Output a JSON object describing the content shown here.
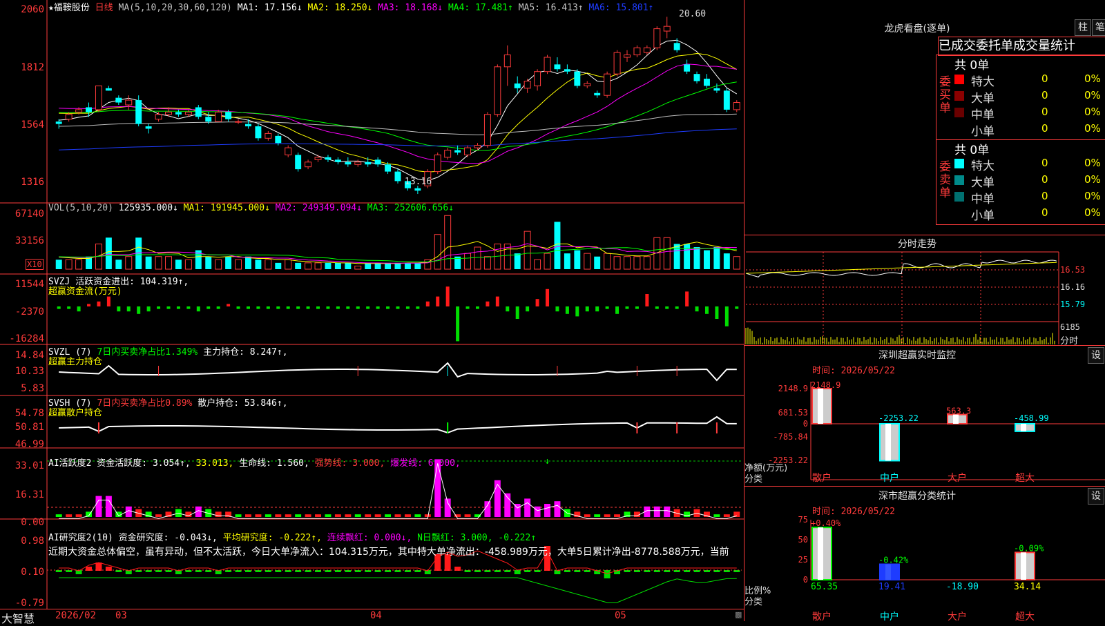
{
  "stock": {
    "name": "★福鞍股份",
    "period": "日线",
    "date_axis": [
      "2026/02",
      "03",
      "04",
      "05"
    ],
    "logo": "大智慧"
  },
  "main_panel": {
    "ma_params": "MA(5,10,20,30,60,120)",
    "ma": [
      {
        "label": "MA1: 17.156↓",
        "color": "#ffffff"
      },
      {
        "label": "MA2: 18.250↓",
        "color": "#ffff00"
      },
      {
        "label": "MA3: 18.168↓",
        "color": "#ff00ff"
      },
      {
        "label": "MA4: 17.481↑",
        "color": "#00ff00"
      },
      {
        "label": "MA5: 16.413↑",
        "color": "#c0c0c0"
      },
      {
        "label": "MA6: 15.801↑",
        "color": "#1e3cff"
      }
    ],
    "y_ticks": [
      "2060",
      "1812",
      "1564",
      "1316"
    ],
    "high_label": "20.60",
    "low_label": "13.16"
  },
  "vol_panel": {
    "legend_name": "VOL(5,10,20)",
    "value": "125935.000↓",
    "ma": [
      {
        "label": "MA1: 191945.000↓",
        "color": "#ffffff"
      },
      {
        "label": "MA2: 249349.094↓",
        "color": "#ff00ff"
      },
      {
        "label": "MA3: 252606.656↓",
        "color": "#00ff00"
      }
    ],
    "y_ticks": [
      "67140",
      "33156"
    ],
    "multiplier": "X10"
  },
  "svzj_panel": {
    "legend": "SVZJ  活跃资金进出: 104.319↑,",
    "title": "超赢资金流(万元)",
    "y_ticks": [
      "11544",
      "-2370",
      "-16284"
    ]
  },
  "svzl_panel": {
    "legend_a": "SVZL (7)",
    "legend_b": "7日内买卖净占比1.349%",
    "legend_c": "主力持仓: 8.247↑,",
    "title": "超赢主力持仓",
    "y_ticks": [
      "14.84",
      "10.33",
      "5.83"
    ]
  },
  "svsh_panel": {
    "legend_a": "SVSH (7)",
    "legend_b": "7日内买卖净占比0.89%",
    "legend_c": "散户持仓: 53.846↑,",
    "title": "超赢散户持仓",
    "y_ticks": [
      "54.78",
      "50.81",
      "46.99"
    ]
  },
  "ai_active_panel": {
    "legend_a": "AI活跃度2 资金活跃度: 3.054↑,",
    "legend_b": "33.013,",
    "legend_c": "生命线: 1.560,",
    "legend_d": "强势线: 3.000,",
    "legend_e": "爆发线: 6.000,",
    "y_ticks": [
      "33.01",
      "16.31",
      "0.00"
    ]
  },
  "ai_research_panel": {
    "legend_a": "AI研究度2(10) 资金研究度: -0.043↓,",
    "legend_b": "平均研究度: -0.222↑,",
    "legend_c": "连续飘红: 0.000↓,",
    "legend_d": "N日飘红: 3.000, -0.222↑",
    "commentary": "近期大资金总体偏空，虽有异动，但不太活跃，今日大单净流入：104.315万元，其中特大单净流出：-458.989万元，大单5日累计净出-8778.588万元，当前",
    "y_ticks": [
      "0.98",
      "0.10",
      "-0.79"
    ]
  },
  "longhu": {
    "title": "龙虎看盘(逐单)",
    "btn_a": "柱",
    "btn_b": "笔",
    "header": "已成交委托单成交量统计",
    "buy_label": "委买单",
    "sell_label": "委卖单",
    "buy_total": "共 0单",
    "sell_total": "共 0单",
    "buy_rows": [
      {
        "name": "特大",
        "count": "0",
        "pct": "0%",
        "color": "#ff0000"
      },
      {
        "name": "大单",
        "count": "0",
        "pct": "0%",
        "color": "#8b0000"
      },
      {
        "name": "中单",
        "count": "0",
        "pct": "0%",
        "color": "#6a0000"
      },
      {
        "name": "小单",
        "count": "0",
        "pct": "0%",
        "color": ""
      }
    ],
    "sell_rows": [
      {
        "name": "特大",
        "count": "0",
        "pct": "0%",
        "color": "#00ffff"
      },
      {
        "name": "大单",
        "count": "0",
        "pct": "0%",
        "color": "#008b8b"
      },
      {
        "name": "中单",
        "count": "0",
        "pct": "0%",
        "color": "#007070"
      },
      {
        "name": "小单",
        "count": "0",
        "pct": "0%",
        "color": ""
      }
    ]
  },
  "intraday": {
    "title": "分时走势",
    "price_ticks": [
      "16.53",
      "16.16",
      "15.79"
    ],
    "vol_tick": "6185",
    "vol_unit": "分时"
  },
  "sz_monitor": {
    "title": "深圳超赢实时监控",
    "btn": "设",
    "time": "时间: 2026/05/22",
    "y_ticks": [
      "2148.9",
      "681.53",
      "0",
      "-785.84",
      "-2253.22"
    ],
    "unit_a": "净额(万元)",
    "unit_b": "分类",
    "bars": [
      {
        "cat": "散户",
        "label": "2148.9"
      },
      {
        "cat": "中户",
        "label": "-2253.22"
      },
      {
        "cat": "大户",
        "label": "563.3"
      },
      {
        "cat": "超大",
        "label": "-458.99"
      }
    ]
  },
  "sz_classify": {
    "title": "深市超赢分类统计",
    "btn": "设",
    "time": "时间: 2026/05/22",
    "y_ticks": [
      "75",
      "50",
      "25",
      "0"
    ],
    "unit_a": "比例%",
    "unit_b": "分类",
    "bars": [
      {
        "cat": "散户",
        "top": "+0.40%",
        "bottom": "65.35"
      },
      {
        "cat": "中户",
        "top": "-0.42%",
        "bottom": "19.41"
      },
      {
        "cat": "大户",
        "top": "",
        "bottom": "-18.90"
      },
      {
        "cat": "超大",
        "top": "-0.09%",
        "bottom": "34.14"
      }
    ]
  },
  "chart_data": {
    "type": "candlestick",
    "ohlc": [
      [
        16.2,
        16.3,
        15.9,
        16.1
      ],
      [
        16.3,
        16.6,
        16.2,
        16.5
      ],
      [
        16.6,
        16.8,
        16.5,
        16.7
      ],
      [
        16.8,
        17.0,
        16.4,
        16.6
      ],
      [
        16.7,
        17.7,
        16.6,
        17.7
      ],
      [
        17.6,
        17.7,
        17.5,
        17.5
      ],
      [
        17.2,
        17.3,
        16.9,
        17.0
      ],
      [
        16.9,
        17.3,
        16.7,
        17.1
      ],
      [
        17.1,
        17.3,
        16.0,
        16.1
      ],
      [
        16.0,
        16.1,
        15.7,
        15.9
      ],
      [
        16.3,
        16.6,
        16.2,
        16.5
      ],
      [
        16.5,
        16.8,
        16.4,
        16.6
      ],
      [
        16.6,
        16.7,
        16.4,
        16.5
      ],
      [
        16.5,
        16.7,
        16.4,
        16.6
      ],
      [
        16.8,
        16.9,
        16.3,
        16.4
      ],
      [
        16.4,
        16.6,
        16.1,
        16.2
      ],
      [
        16.2,
        16.7,
        16.2,
        16.6
      ],
      [
        16.6,
        16.7,
        16.2,
        16.3
      ],
      [
        16.2,
        16.3,
        16.1,
        16.2
      ],
      [
        16.1,
        16.3,
        15.9,
        16.0
      ],
      [
        16.0,
        16.1,
        15.4,
        15.5
      ],
      [
        15.5,
        15.8,
        15.4,
        15.7
      ],
      [
        15.6,
        15.7,
        15.2,
        15.3
      ],
      [
        14.8,
        15.2,
        14.7,
        15.1
      ],
      [
        14.8,
        14.9,
        14.1,
        14.2
      ],
      [
        14.3,
        14.6,
        14.2,
        14.5
      ],
      [
        14.6,
        14.8,
        14.5,
        14.7
      ],
      [
        14.7,
        14.8,
        14.5,
        14.6
      ],
      [
        14.6,
        14.7,
        14.4,
        14.5
      ],
      [
        14.5,
        14.7,
        14.3,
        14.4
      ],
      [
        14.4,
        14.6,
        14.3,
        14.5
      ],
      [
        14.5,
        14.7,
        14.3,
        14.4
      ],
      [
        14.6,
        14.7,
        14.3,
        14.4
      ],
      [
        14.4,
        14.5,
        14.0,
        14.1
      ],
      [
        14.1,
        14.2,
        13.6,
        13.7
      ],
      [
        13.7,
        13.8,
        13.3,
        13.4
      ],
      [
        13.4,
        13.5,
        13.16,
        13.3
      ],
      [
        13.5,
        14.2,
        13.4,
        14.1
      ],
      [
        14.1,
        14.9,
        14.0,
        14.8
      ],
      [
        14.7,
        15.1,
        14.6,
        15.0
      ],
      [
        15.0,
        15.2,
        14.8,
        14.9
      ],
      [
        14.8,
        15.2,
        14.7,
        15.1
      ],
      [
        15.1,
        15.3,
        15.0,
        15.2
      ],
      [
        15.2,
        16.6,
        15.1,
        16.5
      ],
      [
        16.5,
        18.6,
        16.4,
        18.5
      ],
      [
        18.5,
        19.4,
        17.7,
        19.0
      ],
      [
        17.8,
        18.1,
        17.4,
        17.6
      ],
      [
        17.6,
        18.0,
        17.4,
        17.9
      ],
      [
        17.7,
        18.4,
        17.5,
        18.3
      ],
      [
        18.3,
        19.0,
        18.2,
        18.9
      ],
      [
        18.6,
        18.9,
        18.3,
        18.4
      ],
      [
        18.4,
        18.6,
        18.2,
        18.3
      ],
      [
        18.3,
        18.4,
        17.6,
        17.7
      ],
      [
        17.7,
        17.9,
        17.6,
        17.8
      ],
      [
        17.4,
        17.5,
        17.2,
        17.3
      ],
      [
        17.3,
        18.3,
        17.2,
        18.2
      ],
      [
        18.2,
        19.2,
        18.1,
        19.1
      ],
      [
        18.9,
        19.2,
        18.7,
        19.0
      ],
      [
        19.0,
        19.4,
        18.9,
        19.3
      ],
      [
        19.1,
        19.4,
        19.0,
        19.3
      ],
      [
        19.3,
        20.2,
        19.2,
        20.1
      ],
      [
        20.0,
        20.6,
        19.7,
        20.2
      ],
      [
        19.5,
        19.7,
        19.1,
        19.2
      ],
      [
        18.6,
        18.8,
        18.2,
        18.3
      ],
      [
        18.2,
        18.3,
        17.8,
        17.9
      ],
      [
        18.0,
        18.2,
        17.6,
        17.7
      ],
      [
        17.6,
        17.8,
        17.4,
        17.5
      ],
      [
        17.5,
        17.6,
        16.6,
        16.7
      ],
      [
        16.7,
        17.1,
        16.6,
        17.0
      ]
    ],
    "volume": [
      3,
      3,
      3,
      4,
      8,
      10,
      3,
      4,
      10,
      4,
      4,
      4,
      3,
      3,
      6,
      4,
      3,
      4,
      3,
      4,
      3,
      3,
      2,
      3,
      2,
      2,
      2,
      2,
      2,
      2,
      1,
      2,
      2,
      2,
      2,
      2,
      2,
      3,
      11,
      17,
      4,
      5,
      7,
      4,
      8,
      8,
      5,
      12,
      3,
      5,
      15,
      5,
      6,
      5,
      4,
      5,
      4,
      4,
      4,
      4,
      10,
      10,
      8,
      8,
      7,
      6,
      7,
      5,
      4
    ],
    "fund_flow": [
      -1,
      -1,
      -2,
      1,
      2,
      4,
      -2,
      -2,
      -3,
      -2,
      -1,
      -1,
      -1,
      -1,
      -2,
      -1,
      -1,
      1,
      -1,
      -1,
      -1,
      -1,
      -1,
      -1,
      -1,
      -1,
      -1,
      -1,
      -1,
      -1,
      -1,
      -1,
      -1,
      -1,
      -1,
      -1,
      -1,
      2,
      4,
      8,
      -14,
      -1,
      -1,
      2,
      4,
      -2,
      -5,
      -2,
      3,
      7,
      -2,
      -3,
      -4,
      -2,
      -2,
      -1,
      -3,
      -1,
      -1,
      5,
      -1,
      -1,
      -1,
      6,
      -2,
      -3,
      -5,
      -8,
      -1
    ]
  }
}
